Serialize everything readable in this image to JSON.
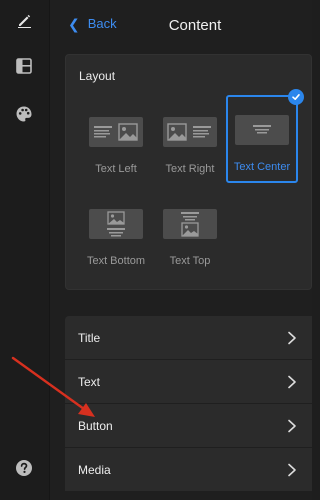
{
  "rail": {
    "icons": [
      "pencil-icon",
      "layout-icon",
      "palette-icon"
    ],
    "help_icon": "question-icon"
  },
  "header": {
    "back_label": "Back",
    "title": "Content"
  },
  "layout": {
    "section_title": "Layout",
    "options": [
      {
        "label": "Text Left",
        "selected": false
      },
      {
        "label": "Text Right",
        "selected": false
      },
      {
        "label": "Text Center",
        "selected": true
      },
      {
        "label": "Text Bottom",
        "selected": false
      },
      {
        "label": "Text Top",
        "selected": false
      }
    ]
  },
  "list": {
    "items": [
      {
        "label": "Title"
      },
      {
        "label": "Text"
      },
      {
        "label": "Button"
      },
      {
        "label": "Media"
      }
    ]
  },
  "colors": {
    "accent": "#2b86ec",
    "annotation_arrow": "#d7301f"
  }
}
